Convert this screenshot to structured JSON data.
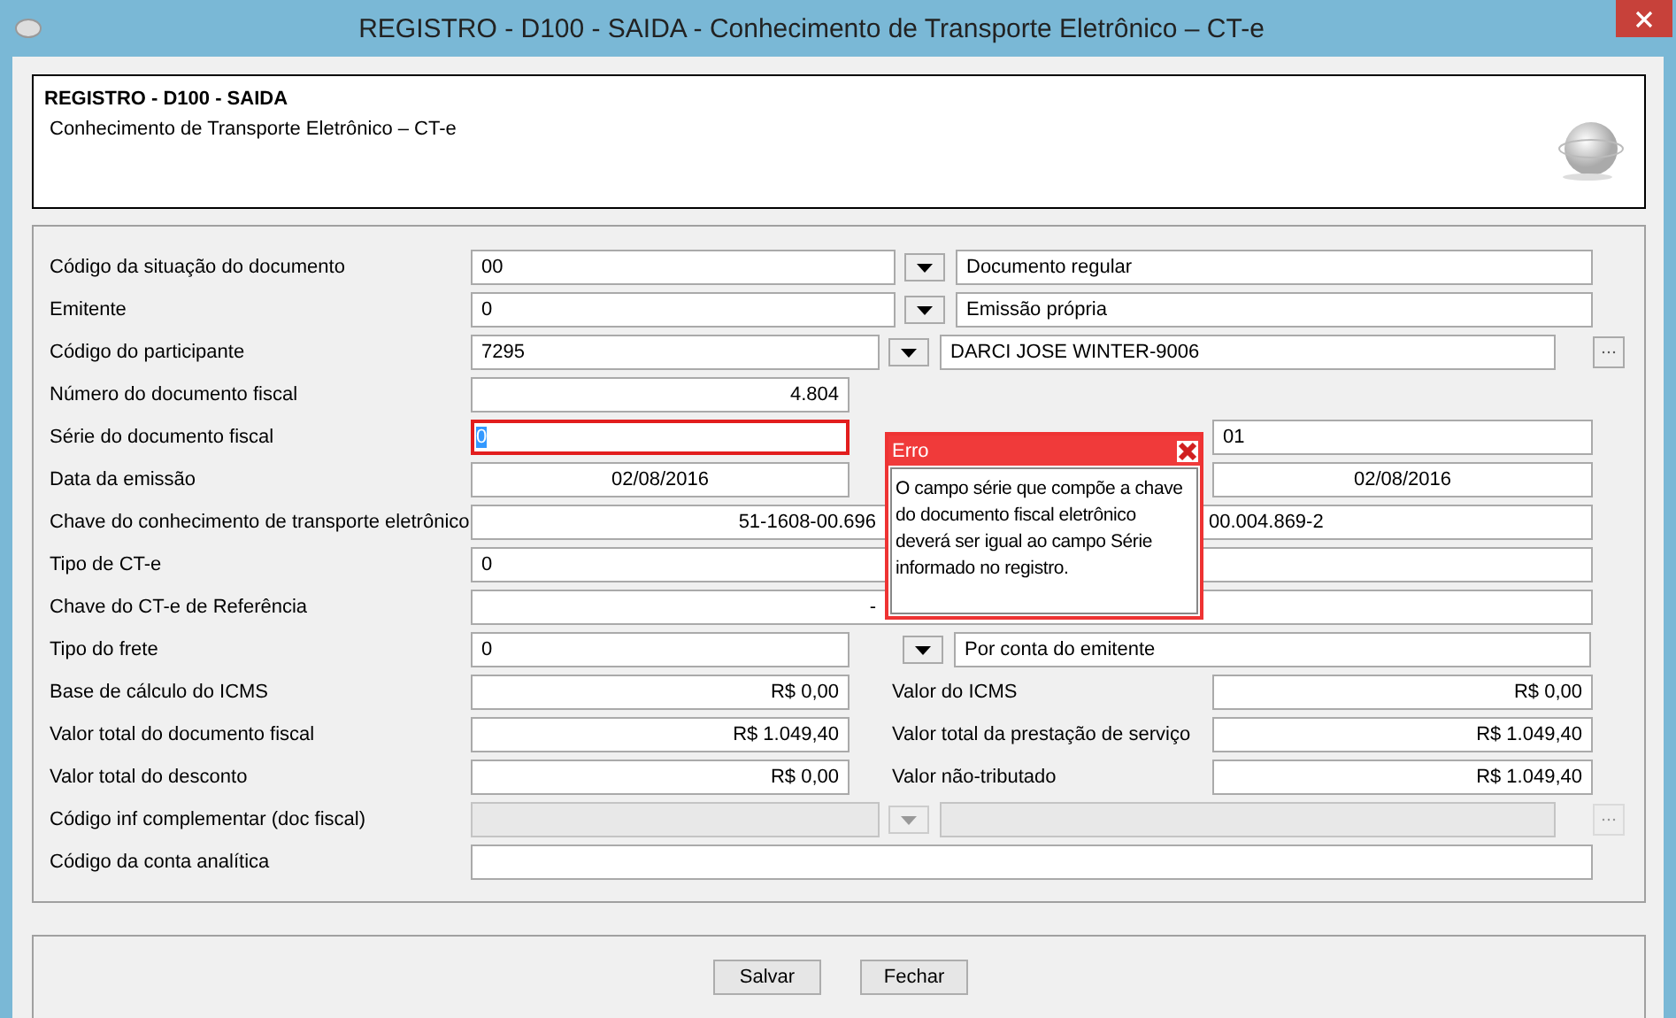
{
  "window": {
    "title": "REGISTRO - D100 - SAIDA - Conhecimento de Transporte Eletrônico – CT-e"
  },
  "header": {
    "title": "REGISTRO - D100 - SAIDA",
    "subtitle": "Conhecimento de Transporte Eletrônico – CT-e"
  },
  "rows": [
    {
      "kind": "combo",
      "label": "Código da situação do documento",
      "value": "00",
      "description": "Documento regular",
      "lookup": false,
      "disabled": false
    },
    {
      "kind": "combo",
      "label": "Emitente",
      "value": "0",
      "description": "Emissão própria",
      "lookup": false,
      "disabled": false
    },
    {
      "kind": "combo-narrow",
      "label": "Código do participante",
      "value": "7295",
      "description": "DARCI JOSE WINTER-9006",
      "lookup": true,
      "disabled": false
    },
    {
      "kind": "short",
      "label": "Número do documento fiscal",
      "value": "4.804"
    },
    {
      "kind": "pair-code",
      "label": "Série do documento fiscal",
      "value": "0",
      "error": true,
      "right_value": "01"
    },
    {
      "kind": "pair-date",
      "label": "Data da emissão",
      "value": "02/08/2016",
      "error": false,
      "right_value": "02/08/2016"
    },
    {
      "kind": "split",
      "label": "Chave do conhecimento de transporte eletrônico",
      "value_left": "51-1608-00.696",
      "value_right": "00.004.869-2"
    },
    {
      "kind": "wide",
      "label": "Tipo de CT-e",
      "value": "0"
    },
    {
      "kind": "split",
      "label": "Chave do CT-e de Referência",
      "value_left": "-",
      "value_right": ""
    },
    {
      "kind": "combo-short",
      "label": "Tipo do frete",
      "value": "0",
      "description": "Por conta do emitente",
      "lookup": false,
      "disabled": false
    },
    {
      "kind": "pair-money",
      "label": "Base de cálculo do ICMS",
      "value": "R$ 0,00",
      "error": false,
      "right_label": "Valor do ICMS",
      "right_value": "R$ 0,00"
    },
    {
      "kind": "pair-money",
      "label": "Valor total do documento fiscal",
      "value": "R$ 1.049,40",
      "error": false,
      "right_label": "Valor total da prestação de serviço",
      "right_value": "R$ 1.049,40"
    },
    {
      "kind": "pair-money",
      "label": "Valor total do desconto",
      "value": "R$ 0,00",
      "error": false,
      "right_label": "Valor não-tributado",
      "right_value": "R$ 1.049,40"
    },
    {
      "kind": "combo-narrow",
      "label": "Código inf complementar (doc fiscal)",
      "value": "",
      "description": "",
      "lookup": true,
      "disabled": true
    },
    {
      "kind": "wide",
      "label": "Código da conta analítica",
      "value": ""
    }
  ],
  "error_popup": {
    "title": "Erro",
    "message": "O campo série que compõe a chave do documento fiscal eletrônico deverá ser igual ao campo Série informado no registro."
  },
  "buttons": [
    "Salvar",
    "Fechar"
  ]
}
